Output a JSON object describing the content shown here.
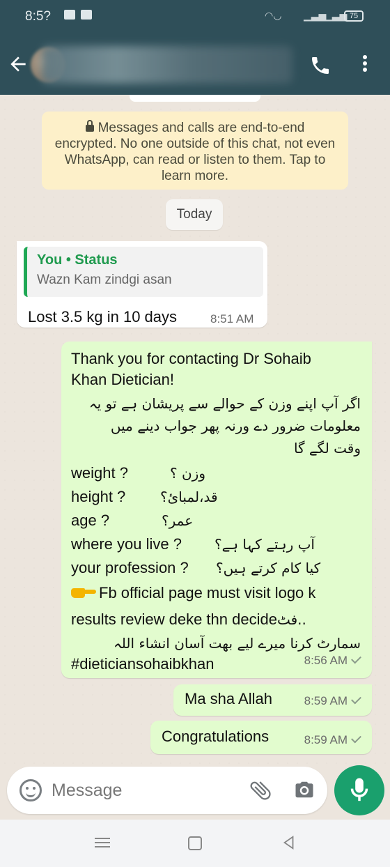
{
  "status_bar": {
    "time": "8:5?",
    "battery": "75"
  },
  "header": {
    "contact_name": "",
    "icons": [
      "back-arrow-icon",
      "call-icon",
      "more-vert-icon"
    ]
  },
  "encryption_notice": "Messages and calls are end-to-end encrypted. No one outside of this chat, not even WhatsApp, can read or listen to them. Tap to learn more.",
  "date_chip": "Today",
  "messages": [
    {
      "direction": "incoming",
      "quote": {
        "author": "You • Status",
        "text": "Wazn Kam zindgi asan"
      },
      "text": "Lost 3.5 kg in 10 days",
      "time": "8:51 AM"
    },
    {
      "direction": "outgoing",
      "lines": {
        "l1": "Thank you for contacting Dr Sohaib",
        "l2": "Khan Dietician!",
        "u1": "اگر آپ اپنے وزن کے حوالے سے پریشان ہے تو یہ",
        "u2": "معلومات ضرور دے ورنہ پھر جواب دینے میں",
        "u3": "وقت لگے گا",
        "weight_en": "weight ?",
        "weight_ur": "وزن ؟",
        "height_en": "height ?",
        "height_ur": "قد،لمبائ؟",
        "age_en": "age  ?",
        "age_ur": "عمر؟",
        "live_en": "where you live ?",
        "live_ur": "آپ رہتے کہا ہے؟",
        "prof_en": "your profession ?",
        "prof_ur": "کیا کام کرتے ہیں؟",
        "fb1": "Fb official page must visit logo k",
        "fb2": "results review deke thn decide",
        "fb2_ur": "فٹ..",
        "u4": "سمارٹ کرنا میرے لیے بھت آسان انشاء اللہ",
        "hashtag": "#dieticiansohaibkhan"
      },
      "time": "8:56 AM",
      "status": "sent"
    },
    {
      "direction": "outgoing",
      "text": "Ma sha Allah",
      "time": "8:59 AM",
      "status": "sent"
    },
    {
      "direction": "outgoing",
      "text": "Congratulations",
      "time": "8:59 AM",
      "status": "sent"
    }
  ],
  "composer": {
    "placeholder": "Message",
    "icons": [
      "emoji-icon",
      "attach-icon",
      "camera-icon",
      "mic-icon"
    ]
  },
  "colors": {
    "app_bar": "#2f4f59",
    "outgoing_bubble": "#e2fcce",
    "incoming_bubble": "#ffffff",
    "accent_green": "#1aa06d"
  }
}
